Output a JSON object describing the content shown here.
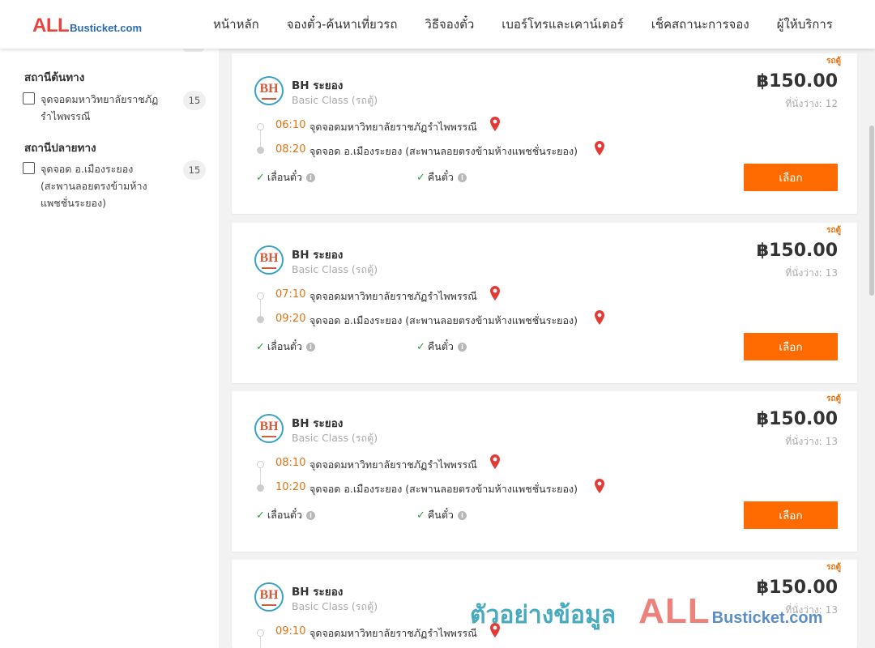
{
  "header": {
    "logo_all": "ALL",
    "logo_rest": "Busticket.com",
    "nav": [
      "หน้าหลัก",
      "จองตั๋ว-ค้นหาเที่ยวรถ",
      "วิธีจองตั๋ว",
      "เบอร์โทรและเคาน์เตอร์",
      "เช็คสถานะการจอง",
      "ผู้ให้บริการ"
    ]
  },
  "sidebar": {
    "origin": {
      "title": "สถานีต้นทาง",
      "items": [
        {
          "label": "จุดจอดมหาวิทยาลัยราชภัฏรำไพพรรณี",
          "count": "15"
        }
      ]
    },
    "destination": {
      "title": "สถานีปลายทาง",
      "items": [
        {
          "label": "จุดจอด อ.เมืองระยอง (สะพานลอยตรงข้ามห้างแพชชั่นระยอง)",
          "count": "15"
        }
      ]
    }
  },
  "trips": [
    {
      "badge": "รถตู้",
      "logo": "BH",
      "operator": "BH ระยอง",
      "bus_class": "Basic Class (รถตู้)",
      "price": "฿150.00",
      "seats_label": "ที่นั่งว่าง:",
      "seats": "12",
      "depart_time": "06:10",
      "depart_stop": "จุดจอดมหาวิทยาลัยราชภัฏรำไพพรรณี",
      "arrive_time": "08:20",
      "arrive_stop": "จุดจอด อ.เมืองระยอง (สะพานลอยตรงข้ามห้างแพชชั่นระยอง)",
      "feature_1": "เลื่อนตั๋ว",
      "feature_2": "คืนตั๋ว",
      "select_label": "เลือก"
    },
    {
      "badge": "รถตู้",
      "logo": "BH",
      "operator": "BH ระยอง",
      "bus_class": "Basic Class (รถตู้)",
      "price": "฿150.00",
      "seats_label": "ที่นั่งว่าง:",
      "seats": "13",
      "depart_time": "07:10",
      "depart_stop": "จุดจอดมหาวิทยาลัยราชภัฏรำไพพรรณี",
      "arrive_time": "09:20",
      "arrive_stop": "จุดจอด อ.เมืองระยอง (สะพานลอยตรงข้ามห้างแพชชั่นระยอง)",
      "feature_1": "เลื่อนตั๋ว",
      "feature_2": "คืนตั๋ว",
      "select_label": "เลือก"
    },
    {
      "badge": "รถตู้",
      "logo": "BH",
      "operator": "BH ระยอง",
      "bus_class": "Basic Class (รถตู้)",
      "price": "฿150.00",
      "seats_label": "ที่นั่งว่าง:",
      "seats": "13",
      "depart_time": "08:10",
      "depart_stop": "จุดจอดมหาวิทยาลัยราชภัฏรำไพพรรณี",
      "arrive_time": "10:20",
      "arrive_stop": "จุดจอด อ.เมืองระยอง (สะพานลอยตรงข้ามห้างแพชชั่นระยอง)",
      "feature_1": "เลื่อนตั๋ว",
      "feature_2": "คืนตั๋ว",
      "select_label": "เลือก"
    },
    {
      "badge": "รถตู้",
      "logo": "BH",
      "operator": "BH ระยอง",
      "bus_class": "Basic Class (รถตู้)",
      "price": "฿150.00",
      "seats_label": "ที่นั่งว่าง:",
      "seats": "13",
      "depart_time": "09:10",
      "depart_stop": "จุดจอดมหาวิทยาลัยราชภัฏรำไพพรรณี",
      "arrive_time": "",
      "arrive_stop": "",
      "feature_1": "",
      "feature_2": "",
      "select_label": ""
    }
  ],
  "watermark": {
    "thai": "ตัวอย่างข้อมูล",
    "all": "ALL",
    "rest": "Busticket.com"
  },
  "colors": {
    "accent_orange": "#ff6b00",
    "time_orange": "#e0720f",
    "check_green": "#2e9e3a",
    "pin_red": "#e53935",
    "logo_red": "#e8433d",
    "logo_blue": "#2a6ab3"
  },
  "icons": {
    "location": "map-pin-icon",
    "check": "check-icon",
    "info": "info-icon"
  }
}
